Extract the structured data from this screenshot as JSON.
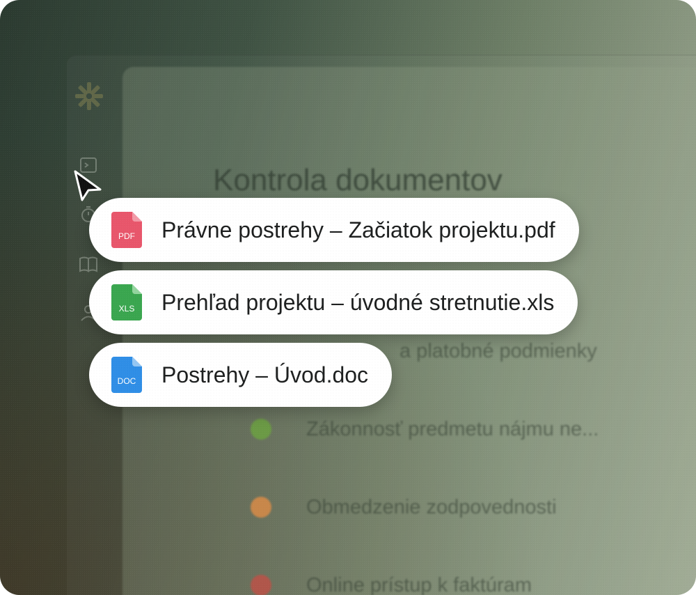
{
  "background_panel": {
    "title": "Kontrola dokumentov",
    "check_items": [
      {
        "label": "a platobné podmienky",
        "status_color": ""
      },
      {
        "label": "Zákonnosť predmetu nájmu ne...",
        "status_color": "#6b9a45"
      },
      {
        "label": "Obmedzenie zodpovednosti",
        "status_color": "#c8874a"
      },
      {
        "label": "Online prístup k faktúram",
        "status_color": "#b0564a"
      }
    ]
  },
  "sidebar": {
    "logo_icon": "asterisk-logo-icon",
    "items": [
      {
        "icon": "terminal-icon"
      },
      {
        "icon": "timer-icon"
      },
      {
        "icon": "book-icon"
      },
      {
        "icon": "user-icon"
      }
    ]
  },
  "files": [
    {
      "name": "Právne postrehy – Začiatok projektu.pdf",
      "type_label": "PDF",
      "color": "#e8566b",
      "icon": "pdf-file-icon"
    },
    {
      "name": "Prehľad projektu – úvodné stretnutie.xls",
      "type_label": "XLS",
      "color": "#3aa64f",
      "icon": "xls-file-icon"
    },
    {
      "name": "Postrehy – Úvod.doc",
      "type_label": "DOC",
      "color": "#2f8ee6",
      "icon": "doc-file-icon"
    }
  ]
}
